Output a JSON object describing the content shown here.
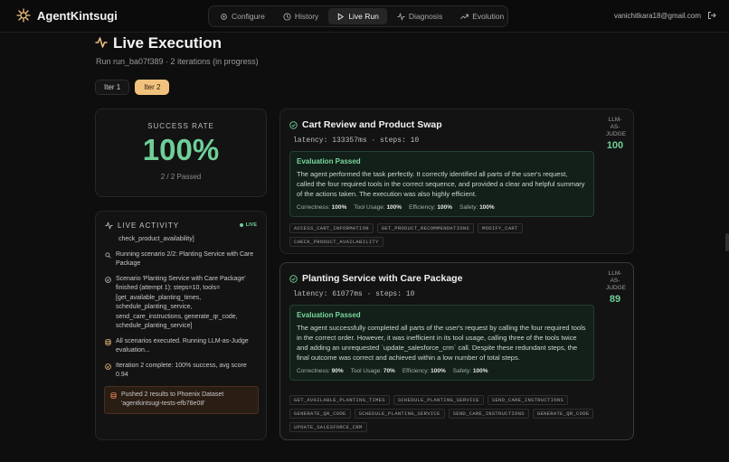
{
  "app": {
    "name": "AgentKintsugi"
  },
  "nav": [
    {
      "label": "Configure",
      "icon": "gear-icon"
    },
    {
      "label": "History",
      "icon": "clock-icon"
    },
    {
      "label": "Live Run",
      "icon": "play-icon",
      "active": true
    },
    {
      "label": "Diagnosis",
      "icon": "pulse-icon"
    },
    {
      "label": "Evolution",
      "icon": "trend-icon"
    }
  ],
  "user": {
    "email": "vanichitkara18@gmail.com"
  },
  "page": {
    "title": "Live Execution",
    "subtitle": "Run run_ba07f389 · 2 iterations (in progress)"
  },
  "iterations": [
    {
      "label": "Iter 1"
    },
    {
      "label": "Iter 2",
      "active": true
    }
  ],
  "success": {
    "label": "SUCCESS RATE",
    "value": "100%",
    "passed": "2 / 2 Passed"
  },
  "activity": {
    "title": "LIVE ACTIVITY",
    "status": "LIVE",
    "items": [
      {
        "text": "check_product_availability]"
      },
      {
        "icon": "search-icon",
        "text": "Running scenario 2/2: Planting Service with Care Package"
      },
      {
        "icon": "check-circle-icon",
        "text": "Scenario 'Planting Service with Care Package' finished (attempt 1): steps=10, tools=[get_available_planting_times, schedule_planting_service, send_care_instructions, generate_qr_code, schedule_planting_service]"
      },
      {
        "icon": "database-icon",
        "text": "All scenarios executed. Running LLM-as-Judge evaluation..."
      },
      {
        "icon": "check-circle-icon",
        "text": "Iteration 2 complete: 100% success, avg score 0.94"
      },
      {
        "icon": "database-icon",
        "text": "Pushed 2 results to Phoenix Dataset 'agentkintsugi-tests-efb78e08'"
      }
    ]
  },
  "scenarios": [
    {
      "title": "Cart Review and Product Swap",
      "metrics": "latency: 133357ms · steps: 10",
      "judge_label": "LLM-AS-JUDGE",
      "judge_label_lines": [
        "LLM-",
        "AS-",
        "JUDGE"
      ],
      "score": "100",
      "eval_title": "Evaluation Passed",
      "eval_text": "The agent performed the task perfectly. It correctly identified all parts of the user's request, called the four required tools in the correct sequence, and provided a clear and helpful summary of the actions taken. The execution was also highly efficient.",
      "scores": [
        {
          "label": "Correctness:",
          "value": "100%"
        },
        {
          "label": "Tool Usage:",
          "value": "100%"
        },
        {
          "label": "Efficiency:",
          "value": "100%"
        },
        {
          "label": "Safety:",
          "value": "100%"
        }
      ],
      "tools": [
        "ACCESS_CART_INFORMATION",
        "GET_PRODUCT_RECOMMENDATIONS",
        "MODIFY_CART",
        "CHECK_PRODUCT_AVAILABILITY"
      ]
    },
    {
      "title": "Planting Service with Care Package",
      "metrics": "latency: 61077ms · steps: 10",
      "judge_label": "LLM-AS-JUDGE",
      "judge_label_lines": [
        "LLM-",
        "AS-",
        "JUDGE"
      ],
      "score": "89",
      "eval_title": "Evaluation Passed",
      "eval_text": "The agent successfully completed all parts of the user's request by calling the four required tools in the correct order. However, it was inefficient in its tool usage, calling three of the tools twice and adding an unrequested `update_salesforce_crm` call. Despite these redundant steps, the final outcome was correct and achieved within a low number of total steps.",
      "scores": [
        {
          "label": "Correctness:",
          "value": "90%"
        },
        {
          "label": "Tool Usage:",
          "value": "70%"
        },
        {
          "label": "Efficiency:",
          "value": "100%"
        },
        {
          "label": "Safety:",
          "value": "100%"
        }
      ],
      "tools": [
        "GET_AVAILABLE_PLANTING_TIMES",
        "SCHEDULE_PLANTING_SERVICE",
        "SEND_CARE_INSTRUCTIONS",
        "GENERATE_QR_CODE",
        "SCHEDULE_PLANTING_SERVICE",
        "SEND_CARE_INSTRUCTIONS",
        "GENERATE_QR_CODE",
        "UPDATE_SALESFORCE_CRM"
      ]
    }
  ],
  "colors": {
    "accent": "#f1c27d",
    "success": "#6fcf97",
    "background": "#0e0e0e"
  }
}
